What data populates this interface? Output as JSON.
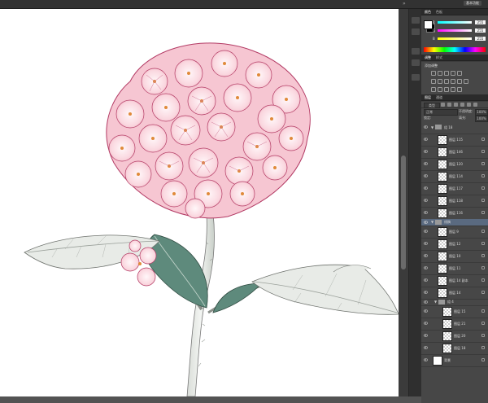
{
  "topbar": {
    "right_tab": "基本功能"
  },
  "color_panel": {
    "tabs": [
      "颜色",
      "色板"
    ],
    "fg_color": "#ffffff",
    "bg_color": "#000000",
    "sliders": [
      {
        "label": "R",
        "value": "255"
      },
      {
        "label": "G",
        "value": "255"
      },
      {
        "label": "B",
        "value": "255"
      }
    ]
  },
  "adjust_panel": {
    "tabs": [
      "调整",
      "样式"
    ],
    "title": "添加调整"
  },
  "layers_panel": {
    "tabs": [
      "图层",
      "通道"
    ],
    "kind_filter": "类型",
    "blend_mode": "正常",
    "opacity_label": "不透明度:",
    "opacity_value": "100%",
    "lock_label": "锁定:",
    "fill_label": "填充:",
    "fill_value": "100%",
    "groups": [
      "组 18",
      "线稿",
      "组 4"
    ],
    "layers": [
      {
        "name": "图层 115",
        "kind": "layer"
      },
      {
        "name": "图层 146",
        "kind": "layer"
      },
      {
        "name": "图层 120",
        "kind": "layer"
      },
      {
        "name": "图层 114",
        "kind": "layer"
      },
      {
        "name": "图层 117",
        "kind": "layer"
      },
      {
        "name": "图层 118",
        "kind": "layer"
      },
      {
        "name": "图层 116",
        "kind": "layer"
      },
      {
        "name": "图层 9",
        "kind": "layer"
      },
      {
        "name": "图层 12",
        "kind": "layer"
      },
      {
        "name": "图层 10",
        "kind": "layer"
      },
      {
        "name": "图层 11",
        "kind": "layer"
      },
      {
        "name": "图层 14 副本",
        "kind": "layer"
      },
      {
        "name": "图层 14",
        "kind": "layer"
      },
      {
        "name": "图层 15",
        "kind": "layer"
      },
      {
        "name": "图层 21",
        "kind": "layer"
      },
      {
        "name": "图层 20",
        "kind": "layer"
      },
      {
        "name": "图层 18",
        "kind": "layer"
      },
      {
        "name": "背景",
        "kind": "background"
      }
    ]
  }
}
